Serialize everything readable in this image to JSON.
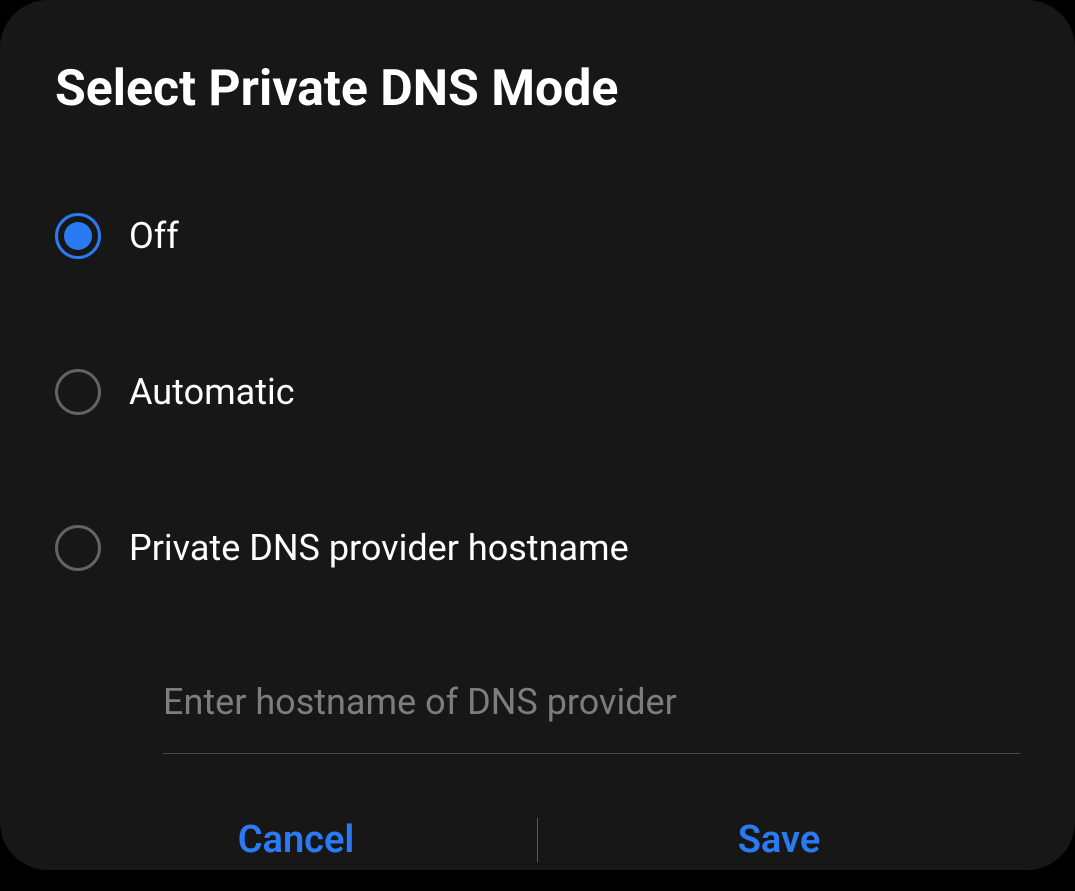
{
  "dialog": {
    "title": "Select Private DNS Mode",
    "options": [
      {
        "label": "Off",
        "selected": true
      },
      {
        "label": "Automatic",
        "selected": false
      },
      {
        "label": "Private DNS provider hostname",
        "selected": false
      }
    ],
    "hostname_input": {
      "placeholder": "Enter hostname of DNS provider",
      "value": ""
    },
    "actions": {
      "cancel_label": "Cancel",
      "save_label": "Save"
    }
  },
  "colors": {
    "accent": "#2a7bf3",
    "background": "#171717",
    "text": "#ffffff",
    "placeholder": "#7d7d7d",
    "border": "#636363"
  }
}
